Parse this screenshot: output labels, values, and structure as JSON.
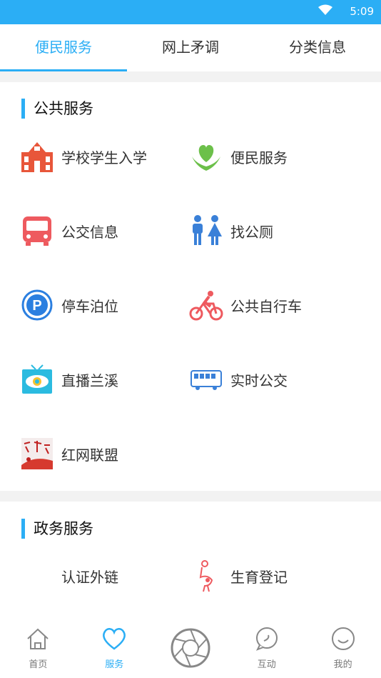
{
  "status": {
    "time": "5:09"
  },
  "tabs": [
    "便民服务",
    "网上矛调",
    "分类信息"
  ],
  "public": {
    "title": "公共服务",
    "items": [
      {
        "label": "学校学生入学",
        "icon": "school-icon"
      },
      {
        "label": "便民服务",
        "icon": "heart-hands-icon"
      },
      {
        "label": "公交信息",
        "icon": "bus-icon"
      },
      {
        "label": "找公厕",
        "icon": "restroom-icon"
      },
      {
        "label": "停车泊位",
        "icon": "parking-icon"
      },
      {
        "label": "公共自行车",
        "icon": "bicycle-icon"
      },
      {
        "label": "直播兰溪",
        "icon": "tv-eye-icon"
      },
      {
        "label": "实时公交",
        "icon": "realtime-bus-icon"
      },
      {
        "label": "红网联盟",
        "icon": "red-alliance-logo"
      }
    ]
  },
  "gov": {
    "title": "政务服务",
    "items": [
      {
        "label": "认证外链"
      },
      {
        "label": "生育登记",
        "icon": "pregnancy-icon"
      }
    ]
  },
  "nav": [
    "首页",
    "服务",
    "",
    "互动",
    "我的"
  ],
  "colors": {
    "accent": "#2baef5"
  }
}
